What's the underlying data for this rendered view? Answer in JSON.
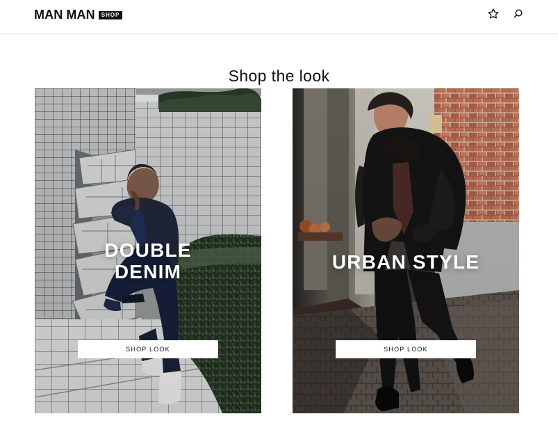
{
  "header": {
    "brand": {
      "name": "MAN MAN",
      "badge": "SHOP"
    },
    "icons": [
      "star-icon",
      "search-icon"
    ]
  },
  "section": {
    "title": "Shop the look"
  },
  "looks": [
    {
      "title": "DOUBLE\nDENIM",
      "button_label": "SHOP LOOK"
    },
    {
      "title": "URBAN STYLE",
      "button_label": "SHOP LOOK"
    }
  ],
  "colors": {
    "background": "#ffffff",
    "text": "#111111",
    "badge_background": "#111111",
    "button_background": "#ffffff",
    "card_title": "#ffffff"
  }
}
